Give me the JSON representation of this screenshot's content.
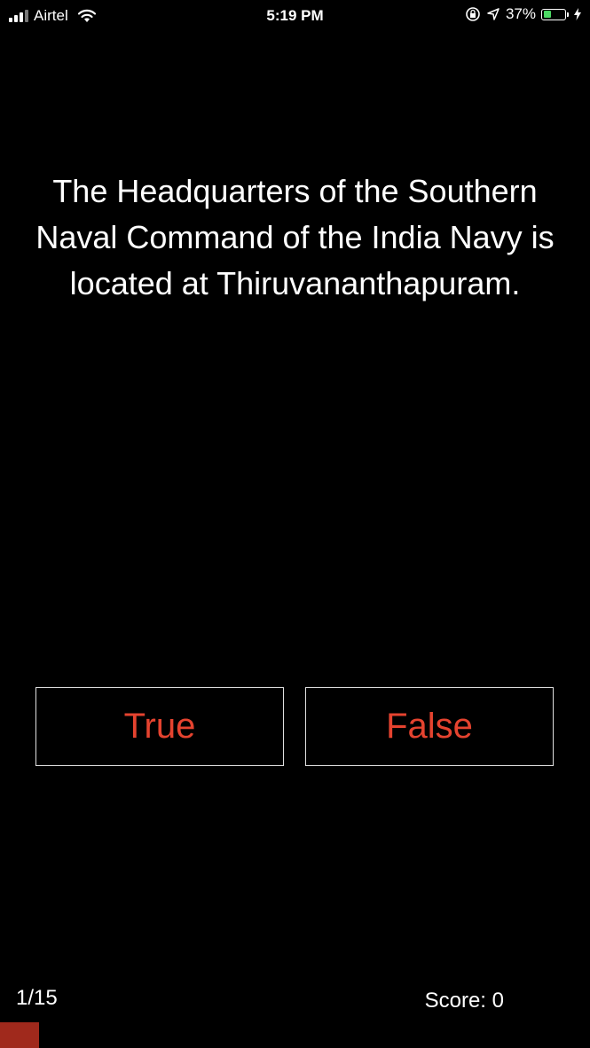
{
  "status_bar": {
    "carrier": "Airtel",
    "time": "5:19 PM",
    "battery_percent": "37%",
    "battery_level": 0.37,
    "icons": [
      "signal-icon",
      "wifi-icon",
      "orientation-lock-icon",
      "location-icon",
      "battery-icon",
      "charging-icon"
    ]
  },
  "quiz": {
    "question": "The Headquarters of the Southern Naval Command of the India Navy is located at Thiruvananthapuram.",
    "true_label": "True",
    "false_label": "False",
    "progress_label": "1/15",
    "score_label": "Score: 0",
    "progress_fraction": 0.0667
  },
  "colors": {
    "background": "#000000",
    "answer_text": "#e5432f",
    "progress_bar": "#a0291c",
    "battery_fill": "#4cd964"
  }
}
